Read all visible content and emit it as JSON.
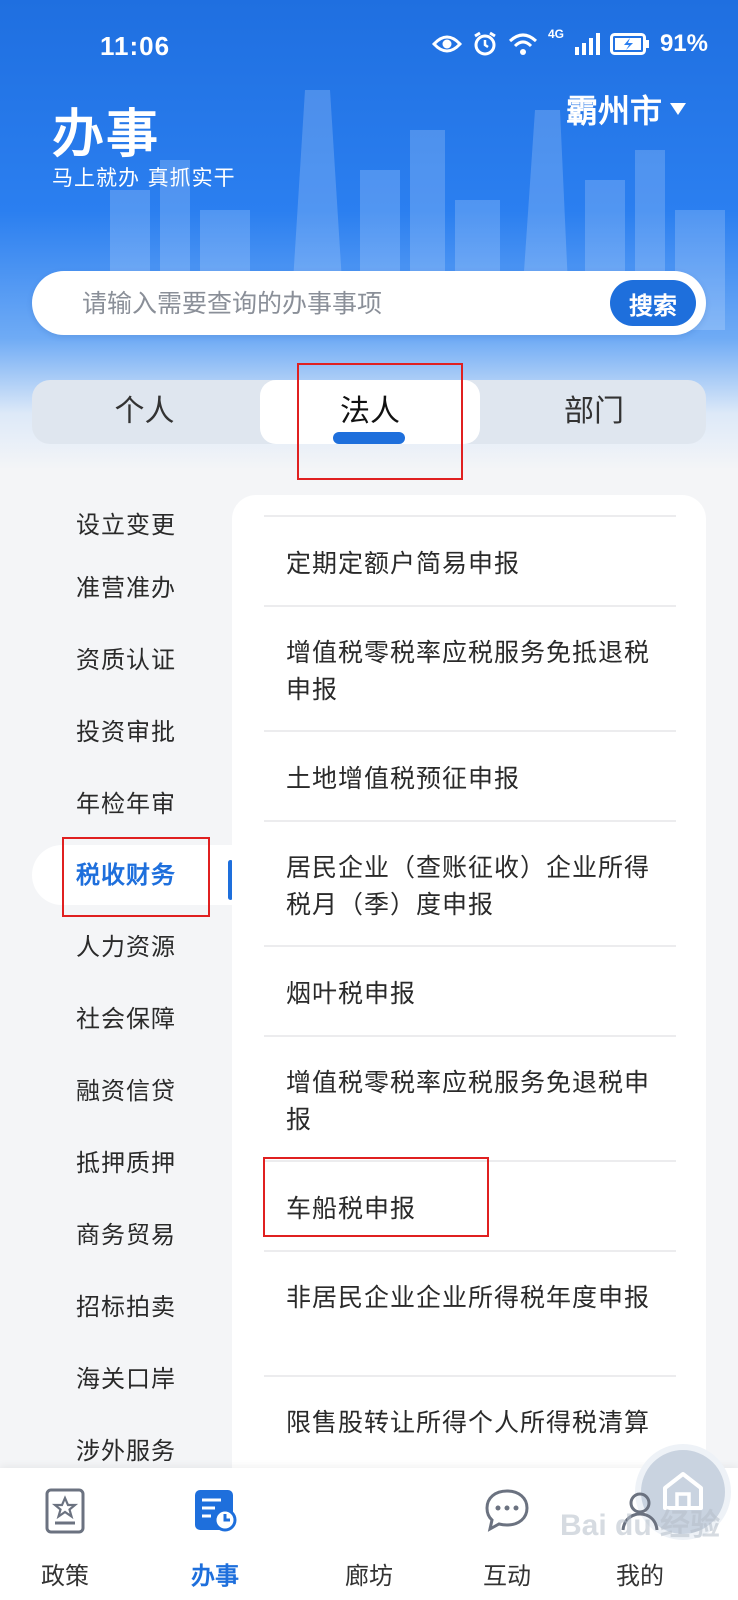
{
  "status": {
    "time": "11:06",
    "battery": "91%",
    "network": "4G"
  },
  "header": {
    "title": "办事",
    "slogan": "马上就办 真抓实干",
    "city": "霸州市"
  },
  "search": {
    "placeholder": "请输入需要查询的办事事项",
    "button_label": "搜索"
  },
  "tabs": [
    {
      "label": "个人",
      "selected": false
    },
    {
      "label": "法人",
      "selected": true
    },
    {
      "label": "部门",
      "selected": false
    }
  ],
  "categories": [
    "设立变更",
    "准营准办",
    "资质认证",
    "投资审批",
    "年检年审",
    "税收财务",
    "人力资源",
    "社会保障",
    "融资信贷",
    "抵押质押",
    "商务贸易",
    "招标拍卖",
    "海关口岸",
    "涉外服务"
  ],
  "selected_category": "税收财务",
  "items": [
    "定期定额户简易申报",
    "增值税零税率应税服务免抵退税申报",
    "土地增值税预征申报",
    "居民企业（查账征收）企业所得税月（季）度申报",
    "烟叶税申报",
    "增值税零税率应税服务免退税申报",
    "车船税申报",
    "非居民企业企业所得税年度申报",
    "限售股转让所得个人所得税清算"
  ],
  "bottom_nav": [
    {
      "label": "政策",
      "icon": "policy-icon",
      "active": false
    },
    {
      "label": "办事",
      "icon": "service-icon",
      "active": true
    },
    {
      "label": "廊坊",
      "icon": "home-icon",
      "active": false
    },
    {
      "label": "互动",
      "icon": "chat-icon",
      "active": false
    },
    {
      "label": "我的",
      "icon": "profile-icon",
      "active": false
    }
  ],
  "watermark": "Bai du 经验",
  "colors": {
    "primary": "#1e6fdc",
    "header_top": "#1f6fe0",
    "annotation": "#e02020",
    "background": "#f4f5f7"
  }
}
